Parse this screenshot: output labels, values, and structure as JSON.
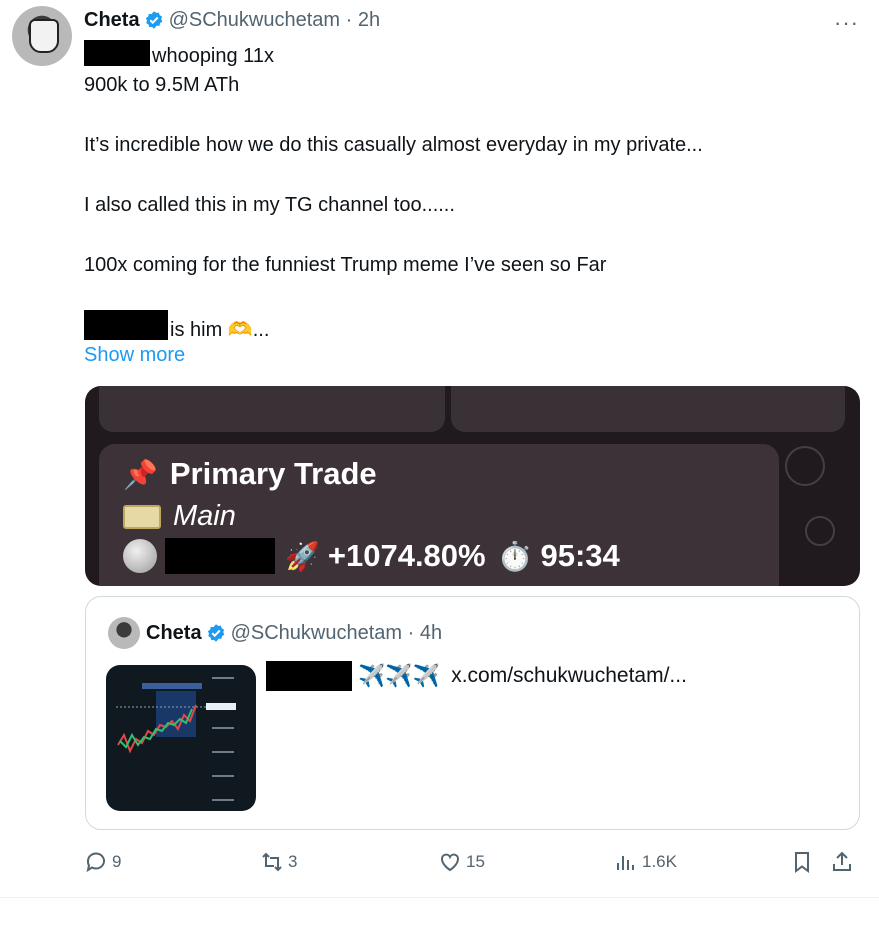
{
  "tweet": {
    "author_name": "Cheta",
    "handle_time": "@SChukwuchetam · 2h",
    "more": "···",
    "line1_suffix": "whooping 11x",
    "line2": "900k to 9.5M ATh",
    "line3": "It’s incredible how we do this casually almost everyday in my private...",
    "line4": "I also called this in my TG channel too......",
    "line5": "100x coming for the funniest Trump meme I’ve seen so Far",
    "line6_suffix": "is him",
    "line6_emoji": "🫶...",
    "show_more": "Show more"
  },
  "media": {
    "title_emoji": "📌",
    "title": "Primary Trade",
    "subtitle": "Main",
    "rocket_emoji": "🚀",
    "gain": "+1074.80%",
    "timer_emoji": "⏱️",
    "time": "95:34"
  },
  "quote": {
    "author_name": "Cheta",
    "handle_time": "@SChukwuchetam · 4h",
    "planes": "✈️✈️✈️",
    "link": "x.com/schukwuchetam/..."
  },
  "actions": {
    "replies": "9",
    "reposts": "3",
    "likes": "15",
    "views": "1.6K"
  },
  "colors": {
    "accent": "#1d9bf0",
    "secondary_text": "#536471",
    "media_bg": "#201a1f"
  }
}
